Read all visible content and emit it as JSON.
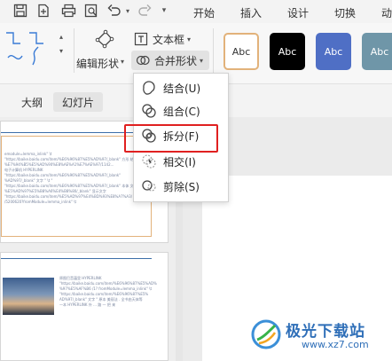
{
  "ribbon": {
    "tabs": [
      "开始",
      "插入",
      "设计",
      "切换",
      "动"
    ],
    "edit_shape_label": "编辑形状",
    "edit_shape_chevron": "▾",
    "textbox_label": "文本框",
    "textbox_chevron": "▾",
    "merge_shape_label": "合并形状",
    "merge_shape_chevron": "▾",
    "shape_styles": [
      {
        "label": "Abc",
        "bg": "#ffffff",
        "fg": "#333333",
        "border": "#e2b27a"
      },
      {
        "label": "Abc",
        "bg": "#000000",
        "fg": "#ffffff",
        "border": "#000000"
      },
      {
        "label": "Abc",
        "bg": "#4f6fc5",
        "fg": "#ffffff",
        "border": "#4f6fc5"
      },
      {
        "label": "Abc",
        "bg": "#6f96a8",
        "fg": "#ffffff",
        "border": "#6f96a8"
      }
    ]
  },
  "view_tabs": {
    "outline": "大纲",
    "slides": "幻灯片"
  },
  "merge_menu": {
    "items": [
      {
        "label": "结合(U)",
        "icon": "union-icon"
      },
      {
        "label": "组合(C)",
        "icon": "combine-icon"
      },
      {
        "label": "拆分(F)",
        "icon": "fragment-icon"
      },
      {
        "label": "相交(I)",
        "icon": "intersect-icon"
      },
      {
        "label": "剪除(S)",
        "icon": "subtract-icon"
      }
    ],
    "highlight_color": "#e02020"
  },
  "slide1": {
    "lines": [
      "emodule=lemma_inlink\" \\t",
      "\"https://baike.baidu.com/item/%E6%96%87%E5%AD%97/_blank\" 方形 结",
      "%E7%94%B5%E5%AD%90%E8%AE%A1%E7%AE%97/1142...",
      "电子计算机 HYPERLINK",
      "\"https://baike.baidu.com/item/%E6%96%87%E5%AD%97/_blank\"",
      "%AD%97/_blank\" 文字 \" \\t \"",
      "\"https://baike.baidu.com/item/%E6%96%87%E5%AD%97/_blank\" 本体 文字",
      "%E5%AD%97%E5%B8%A6%E4%B8%80/_blank\" 显示文字",
      "\"https://baike.baidu.com/item/%E5%AD%97%E4%BD%93%E8%A7%A3/",
      "/5200620?fromModule=lemma_inlink\" \\t"
    ]
  },
  "slide2": {
    "lines": [
      "原图巴音蕴里 HYPERLINK",
      "\"https://baike.baidu.com/item/%E6%96%87%E5%AD%97",
      "%97%E5%AF%B6 /1? fromModule=lemma_inlink\" \\t",
      "\"https://baike.baidu.com/item/%E6%96%87%E5%",
      "AD%97/_blank\" 文字 \" 原本 美丽法 . 全书由天体等",
      "一本 HYPERLINK 外 … 路 一 把 来"
    ]
  },
  "watermark": {
    "cn": "极光下载站",
    "url": "www.xz7.com"
  }
}
